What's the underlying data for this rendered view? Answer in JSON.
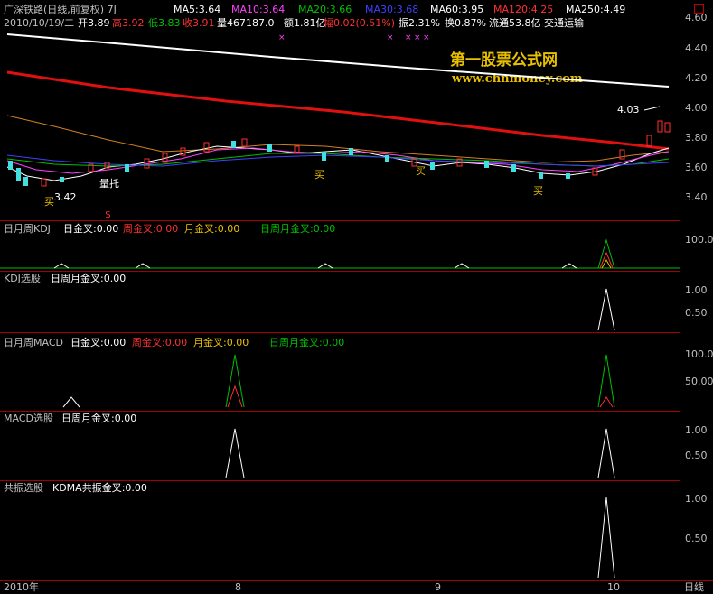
{
  "header": {
    "stock_title": "广深铁路(日线,前复权) 7J",
    "ma5": "MA5:3.64",
    "ma10": "MA10:3.64",
    "ma20": "MA20:3.66",
    "ma30": "MA30:3.68",
    "ma60": "MA60:3.95",
    "ma120": "MA120:4.25",
    "ma250": "MA250:4.49"
  },
  "quote": {
    "date": "2010/10/19/二",
    "open": "开3.89",
    "high": "高3.92",
    "low": "低3.83",
    "close": "收3.91",
    "volume": "量467187.0",
    "amount": "额1.81亿",
    "change": "幅0.02(0.51%)",
    "amplitude": "振2.31%",
    "turnover": "换0.87%",
    "float_cap": "流通53.8亿",
    "sector": "交通运输"
  },
  "watermark": {
    "name": "第一股票公式网",
    "url": "www.chnmoney.com"
  },
  "main_chart": {
    "price_ticks": [
      "4.60",
      "4.40",
      "4.20",
      "4.00",
      "3.80",
      "3.60",
      "3.40"
    ],
    "annotations": {
      "high_price": "4.03",
      "low_price": "3.42",
      "volume_hint": "量托",
      "buy": "买",
      "sell_marker": "$"
    }
  },
  "panels": {
    "kdj_week": {
      "title": "日月周KDJ",
      "f1": "日金叉:0.00",
      "f2": "周金叉:0.00",
      "f3": "月金叉:0.00",
      "f4": "日周月金叉:0.00",
      "ticks": [
        "100.0"
      ]
    },
    "kdj_pick": {
      "title": "KDJ选股",
      "f1": "日周月金叉:0.00",
      "ticks": [
        "1.00",
        "0.50"
      ]
    },
    "macd_week": {
      "title": "日月周MACD",
      "f1": "日金叉:0.00",
      "f2": "周金叉:0.00",
      "f3": "月金叉:0.00",
      "f4": "日周月金叉:0.00",
      "ticks": [
        "100.0",
        "50.00"
      ]
    },
    "macd_pick": {
      "title": "MACD选股",
      "f1": "日周月金叉:0.00",
      "ticks": [
        "1.00",
        "0.50"
      ]
    },
    "resonance": {
      "title": "共振选股",
      "f1": "KDMA共振金叉:0.00",
      "ticks": [
        "1.00",
        "0.50"
      ]
    }
  },
  "time_axis": {
    "year": "2010年",
    "m8": "8",
    "m9": "9",
    "m10": "10",
    "period": "日线"
  },
  "colors": {
    "red": "#ff3030",
    "green": "#00c000",
    "cyan": "#40e0e0",
    "yellow": "#e8c000",
    "magenta": "#ff40ff",
    "white": "#ffffff"
  }
}
